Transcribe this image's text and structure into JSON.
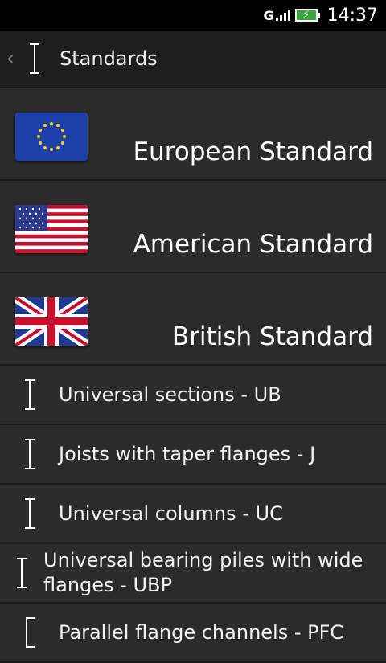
{
  "status": {
    "time": "14:37",
    "network": "G"
  },
  "header": {
    "title": "Standards"
  },
  "standards": [
    {
      "label": "European Standard",
      "flag": "eu-flag-icon"
    },
    {
      "label": "American Standard",
      "flag": "us-flag-icon"
    },
    {
      "label": "British Standard",
      "flag": "uk-flag-icon"
    }
  ],
  "sections": [
    {
      "label": "Universal sections - UB",
      "icon": "i-beam-icon"
    },
    {
      "label": "Joists with taper flanges - J",
      "icon": "i-beam-icon"
    },
    {
      "label": "Universal columns - UC",
      "icon": "i-beam-icon"
    },
    {
      "label": "Universal bearing piles with wide flanges - UBP",
      "icon": "i-beam-icon"
    },
    {
      "label": "Parallel flange channels - PFC",
      "icon": "channel-icon"
    }
  ]
}
